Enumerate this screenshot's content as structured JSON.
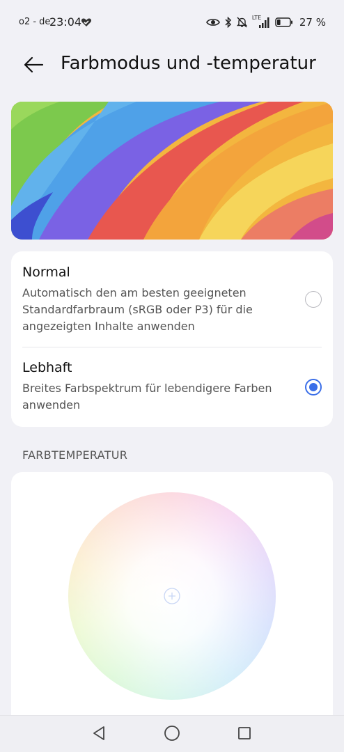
{
  "status_bar": {
    "carrier": "o2 - de",
    "time": "23:04",
    "heart_icon": "heart-check-icon",
    "network_label": "LTE",
    "battery_text": "27 %",
    "battery_level": 0.27
  },
  "header": {
    "back_icon": "arrow-left-icon",
    "title": "Farbmodus und -temperatur"
  },
  "modes": [
    {
      "title": "Normal",
      "description": "Automatisch den am besten geeigneten Standardfarbraum (sRGB oder P3) für die angezeigten Inhalte anwenden",
      "selected": false
    },
    {
      "title": "Lebhaft",
      "description": "Breites Farbspektrum für lebendigere Farben anwenden",
      "selected": true
    }
  ],
  "temperature": {
    "section_label": "FARBTEMPERATUR",
    "marker_icon": "crosshair-icon"
  },
  "colors": {
    "accent": "#3a6ee8",
    "background": "#f1f1f6",
    "card": "#ffffff"
  },
  "navigation": {
    "back_icon": "triangle-back-icon",
    "home_icon": "circle-home-icon",
    "recents_icon": "square-recents-icon"
  }
}
